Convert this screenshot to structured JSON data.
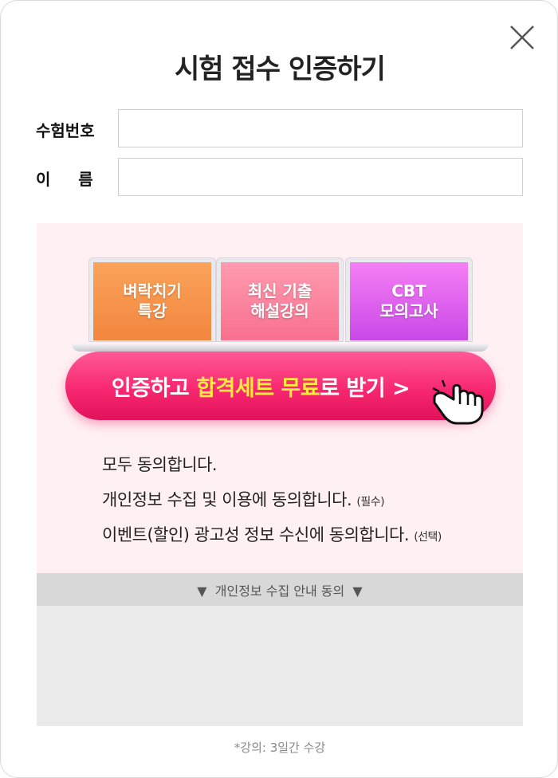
{
  "title": "시험 접수 인증하기",
  "form": {
    "exam_number_label": "수험번호",
    "name_label": "이     름",
    "exam_number_value": "",
    "name_value": ""
  },
  "laptops": [
    {
      "line1": "벼락치기",
      "line2": "특강",
      "color_top": "#fba35a",
      "color_bottom": "#f2863e"
    },
    {
      "line1": "최신 기출",
      "line2": "해설강의",
      "color_top": "#ff9bb0",
      "color_bottom": "#f8708e"
    },
    {
      "line1": "CBT",
      "line2": "모의고사",
      "color_top": "#f57ff4",
      "color_bottom": "#c948e8"
    }
  ],
  "cta": {
    "part1": "인증하고 ",
    "highlight": "합격세트 무료",
    "part2": "로 받기 >"
  },
  "agreements": [
    {
      "text": "모두 동의합니다.",
      "tag": ""
    },
    {
      "text": "개인정보 수집 및 이용에 동의합니다. ",
      "tag": "(필수)"
    },
    {
      "text": "이벤트(할인) 광고성 정보 수신에 동의합니다. ",
      "tag": "(선택)"
    }
  ],
  "info_bar": "▼  개인정보 수집 안내 동의  ▼",
  "note": "*강의: 3일간 수강",
  "colors": {
    "cta": "#f8286f",
    "highlight": "#ffec3d",
    "promo_bg": "#fff0f3"
  }
}
